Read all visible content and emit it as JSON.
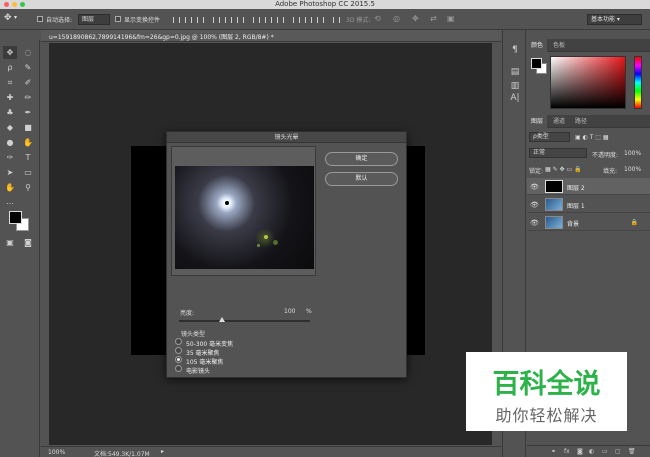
{
  "app": {
    "title": "Adobe Photoshop CC 2015.5",
    "workspace": "基本功能",
    "traffic_colors": [
      "#fc605c",
      "#fdbc40",
      "#34c84a"
    ]
  },
  "options_bar": {
    "auto_select_label": "自动选择:",
    "auto_select_value": "图层",
    "show_transform_label": "显示变换控件",
    "mode_3d_label": "3D 模式:"
  },
  "document": {
    "tab_title": "u=1591890862,789914196&fm=26&gp=0.jpg @ 100% (图层 2, RGB/8#) *",
    "zoom": "100%",
    "doc_info": "文档:549.3K/1.07M"
  },
  "color_panel": {
    "tabs": [
      "颜色",
      "色板"
    ],
    "foreground": "#000000",
    "background": "#ffffff"
  },
  "layers_panel": {
    "tabs": [
      "图层",
      "通道",
      "路径"
    ],
    "filter_label": "ρ类型",
    "blend_mode": "正常",
    "opacity_label": "不透明度:",
    "opacity": "100%",
    "lock_label": "锁定:",
    "fill_label": "填充:",
    "fill": "100%",
    "layers": [
      {
        "name": "图层 2",
        "selected": true
      },
      {
        "name": "图层 1",
        "selected": false
      },
      {
        "name": "背景",
        "selected": false
      }
    ]
  },
  "dialog": {
    "title": "镜头光晕",
    "ok_label": "确定",
    "reset_label": "默认",
    "brightness_label": "亮度:",
    "brightness_value": "100",
    "brightness_unit": "%",
    "brightness_fraction": 0.33,
    "lens_type_label": "镜头类型",
    "lens_options": [
      "50-300 毫米变焦",
      "35 毫米聚焦",
      "105 毫米聚焦",
      "电影镜头"
    ],
    "selected_lens_index": 2
  },
  "watermark": {
    "title": "百科全说",
    "subtitle": "助你轻松解决"
  }
}
